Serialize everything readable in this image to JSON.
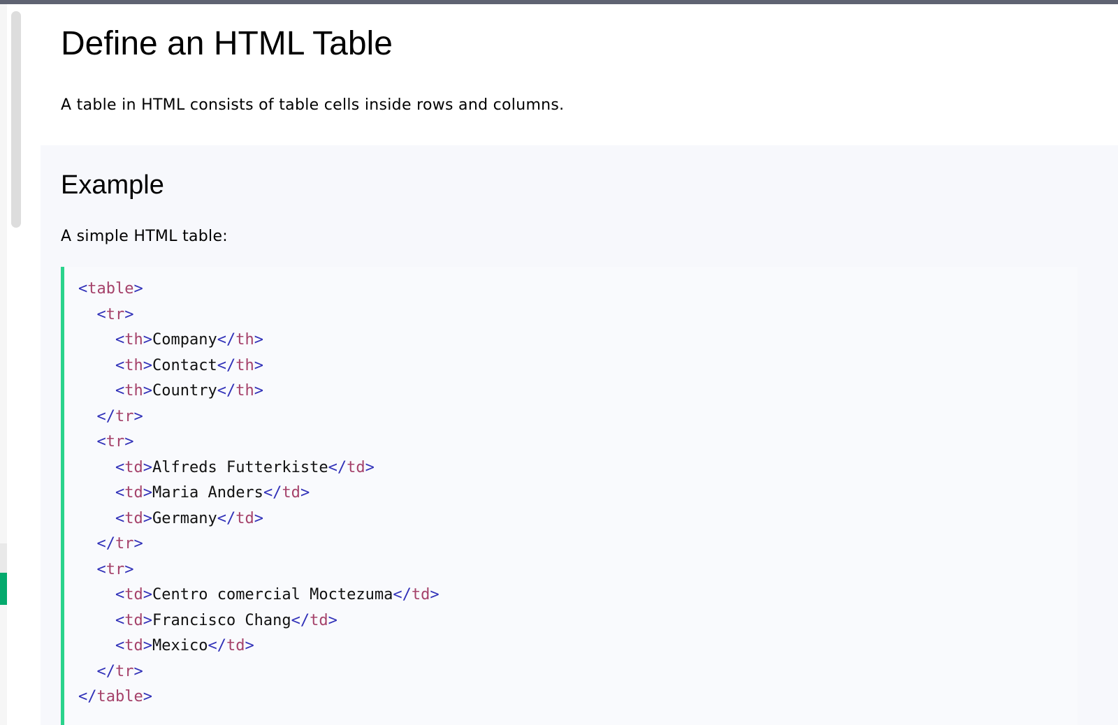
{
  "page": {
    "title": "Define an HTML Table",
    "intro": "A table in HTML consists of table cells inside rows and columns."
  },
  "example": {
    "heading": "Example",
    "description": "A simple HTML table:"
  },
  "code": {
    "lines": [
      {
        "indent": "",
        "open_tag": "table",
        "text": "",
        "close_tag": ""
      },
      {
        "indent": "  ",
        "open_tag": "tr",
        "text": "",
        "close_tag": ""
      },
      {
        "indent": "    ",
        "open_tag": "th",
        "text": "Company",
        "close_tag": "th"
      },
      {
        "indent": "    ",
        "open_tag": "th",
        "text": "Contact",
        "close_tag": "th"
      },
      {
        "indent": "    ",
        "open_tag": "th",
        "text": "Country",
        "close_tag": "th"
      },
      {
        "indent": "  ",
        "open_tag": "",
        "text": "",
        "close_tag": "tr"
      },
      {
        "indent": "  ",
        "open_tag": "tr",
        "text": "",
        "close_tag": ""
      },
      {
        "indent": "    ",
        "open_tag": "td",
        "text": "Alfreds Futterkiste",
        "close_tag": "td"
      },
      {
        "indent": "    ",
        "open_tag": "td",
        "text": "Maria Anders",
        "close_tag": "td"
      },
      {
        "indent": "    ",
        "open_tag": "td",
        "text": "Germany",
        "close_tag": "td"
      },
      {
        "indent": "  ",
        "open_tag": "",
        "text": "",
        "close_tag": "tr"
      },
      {
        "indent": "  ",
        "open_tag": "tr",
        "text": "",
        "close_tag": ""
      },
      {
        "indent": "    ",
        "open_tag": "td",
        "text": "Centro comercial Moctezuma",
        "close_tag": "td"
      },
      {
        "indent": "    ",
        "open_tag": "td",
        "text": "Francisco Chang",
        "close_tag": "td"
      },
      {
        "indent": "    ",
        "open_tag": "td",
        "text": "Mexico",
        "close_tag": "td"
      },
      {
        "indent": "  ",
        "open_tag": "",
        "text": "",
        "close_tag": "tr"
      },
      {
        "indent": "",
        "open_tag": "",
        "text": "",
        "close_tag": "table"
      }
    ]
  },
  "colors": {
    "accent_green": "#04aa6d",
    "code_border": "#2bd38c",
    "tag_color": "#a5426a",
    "bracket_color": "#3030b8"
  }
}
